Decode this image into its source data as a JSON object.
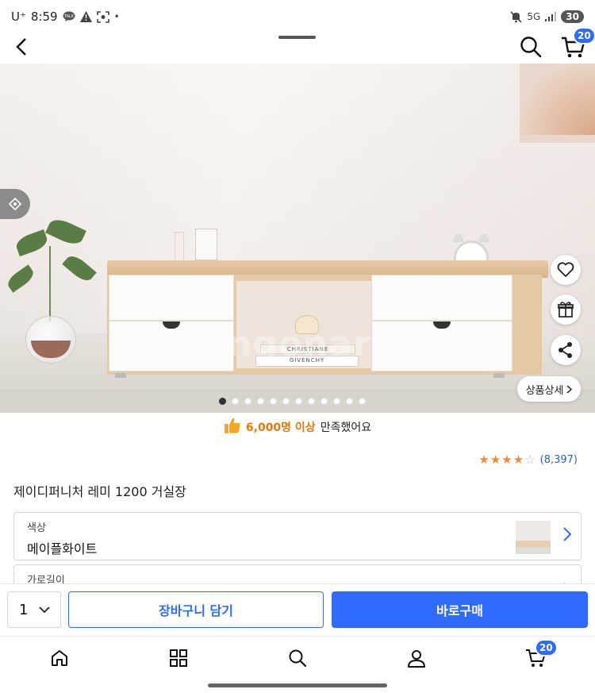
{
  "status_bar": {
    "carrier": "U⁺",
    "time": "8:59",
    "icons_left": [
      "talk-icon",
      "warning-icon",
      "screenshot-icon",
      "dot"
    ],
    "network": "5G",
    "battery": "30"
  },
  "header": {
    "cart_count": "20"
  },
  "hero": {
    "watermark": "Joongonara",
    "book_top": "CHRISTIANE",
    "book_bottom": "GIVENCHY",
    "detail_button": "상품상세",
    "dot_count": 12,
    "active_dot": 0
  },
  "satisfaction": {
    "highlight": "6,000명 이상",
    "suffix": "만족했어요"
  },
  "rating": {
    "stars": 4,
    "max_stars": 5,
    "count": "(8,397)"
  },
  "product": {
    "title": "제이디퍼니처 레미 1200 거실장"
  },
  "options": [
    {
      "label": "색상",
      "value": "메이플화이트"
    },
    {
      "label": "가로길이",
      "value": ""
    }
  ],
  "purchase": {
    "quantity": "1",
    "cart_button": "장바구니 담기",
    "buy_button": "바로구매"
  },
  "bottom_nav": {
    "cart_count": "20"
  },
  "colors": {
    "accent": "#2f6bff",
    "orange": "#e07a10",
    "star": "#f5883b"
  }
}
